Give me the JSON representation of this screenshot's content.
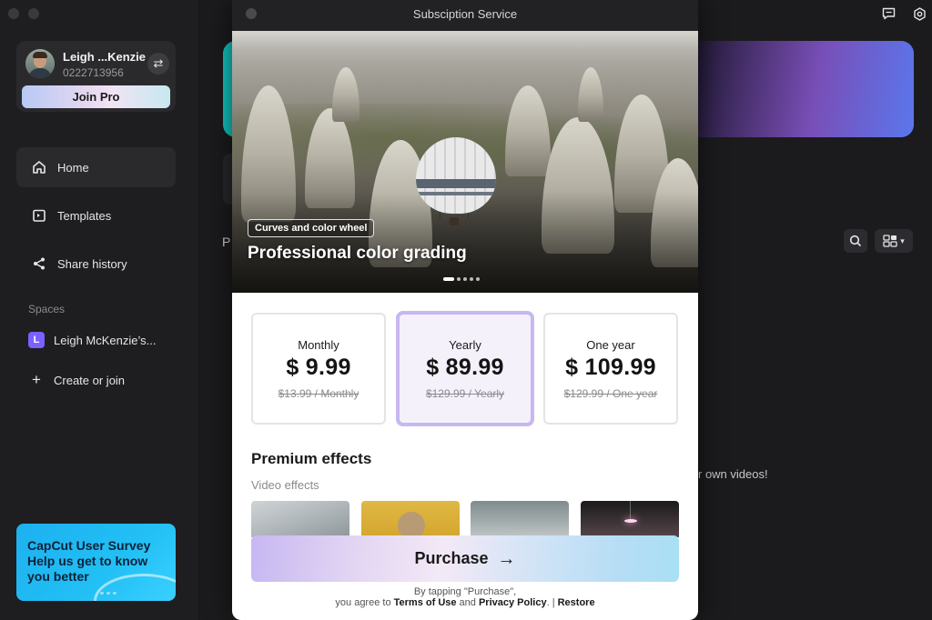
{
  "sidebar": {
    "profile": {
      "name": "Leigh ...Kenzie",
      "id": "0222713956",
      "join_pro_label": "Join Pro"
    },
    "nav": [
      {
        "label": "Home",
        "icon": "home-icon",
        "active": true
      },
      {
        "label": "Templates",
        "icon": "templates-icon",
        "active": false
      },
      {
        "label": "Share history",
        "icon": "share-icon",
        "active": false
      }
    ],
    "spaces_title": "Spaces",
    "space": {
      "badge": "L",
      "name": "Leigh McKenzie’s...",
      "badge_color": "#7b61ff"
    },
    "create_label": "Create or join",
    "survey": {
      "text": "CapCut User Survey Help us get to know you better"
    }
  },
  "main": {
    "section_initial": "P",
    "own_videos_text": "r own videos!"
  },
  "modal": {
    "title": "Subsciption Service",
    "hero": {
      "tag": "Curves and color wheel",
      "title": "Professional color grading",
      "slide_count": 5,
      "active_slide": 1
    },
    "plans": [
      {
        "name": "Monthly",
        "price": "$ 9.99",
        "original": "$13.99 / Monthly",
        "selected": false
      },
      {
        "name": "Yearly",
        "price": "$ 89.99",
        "original": "$129.99 / Yearly",
        "selected": true
      },
      {
        "name": "One year",
        "price": "$ 109.99",
        "original": "$129.99 / One year",
        "selected": false
      }
    ],
    "premium_title": "Premium effects",
    "video_effects_label": "Video effects",
    "purchase_label": "Purchase",
    "fine_print": {
      "line1": "By tapping \"Purchase\",",
      "prefix": "you agree to ",
      "terms": "Terms of Use",
      "and": " and ",
      "privacy": "Privacy Policy",
      "sep": ". | ",
      "restore": "Restore"
    }
  },
  "colors": {
    "accent_space": "#7b61ff",
    "survey_bg": "#22c0f5"
  }
}
